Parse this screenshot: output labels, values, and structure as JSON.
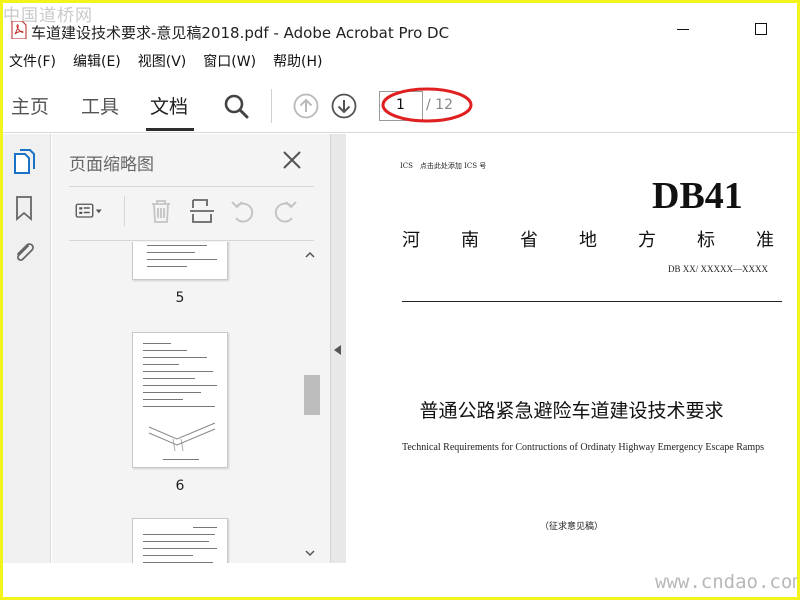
{
  "watermark": {
    "top": "中国道桥网",
    "bottom": "www.cndao.com"
  },
  "window": {
    "title": "车道建设技术要求-意见稿2018.pdf - Adobe Acrobat Pro DC"
  },
  "menu": [
    "文件(F)",
    "编辑(E)",
    "视图(V)",
    "窗口(W)",
    "帮助(H)"
  ],
  "toolbar": {
    "tabs": {
      "home": "主页",
      "tools": "工具",
      "document": "文档"
    },
    "page_current": "1",
    "page_total": "/ 12"
  },
  "thumbnail_panel": {
    "title": "页面缩略图",
    "pages": [
      "5",
      "6"
    ]
  },
  "document": {
    "ics": "ICS　点击此处添加 ICS 号",
    "standard_code": "DB41",
    "province_chars": [
      "河",
      "南",
      "省",
      "地",
      "方",
      "标",
      "准"
    ],
    "db_number": "DB XX/ XXXXX—XXXX",
    "title_cn": "普通公路紧急避险车道建设技术要求",
    "title_en": "Technical Requirements for Contructions of Ordinaty Highway Emergency Escape Ramps",
    "draft_label": "（征求意见稿）"
  },
  "colors": {
    "annotation": "#e02020",
    "accent": "#1a73c7",
    "frame": "#f4f41c"
  },
  "icons": [
    "pdf-file-icon",
    "search-icon",
    "arrow-up-circle-icon",
    "arrow-down-circle-icon",
    "page-thumbnails-icon",
    "bookmark-icon",
    "paperclip-icon",
    "close-icon",
    "thumbnail-options-icon",
    "delete-icon",
    "insert-page-icon",
    "undo-icon",
    "redo-icon"
  ]
}
